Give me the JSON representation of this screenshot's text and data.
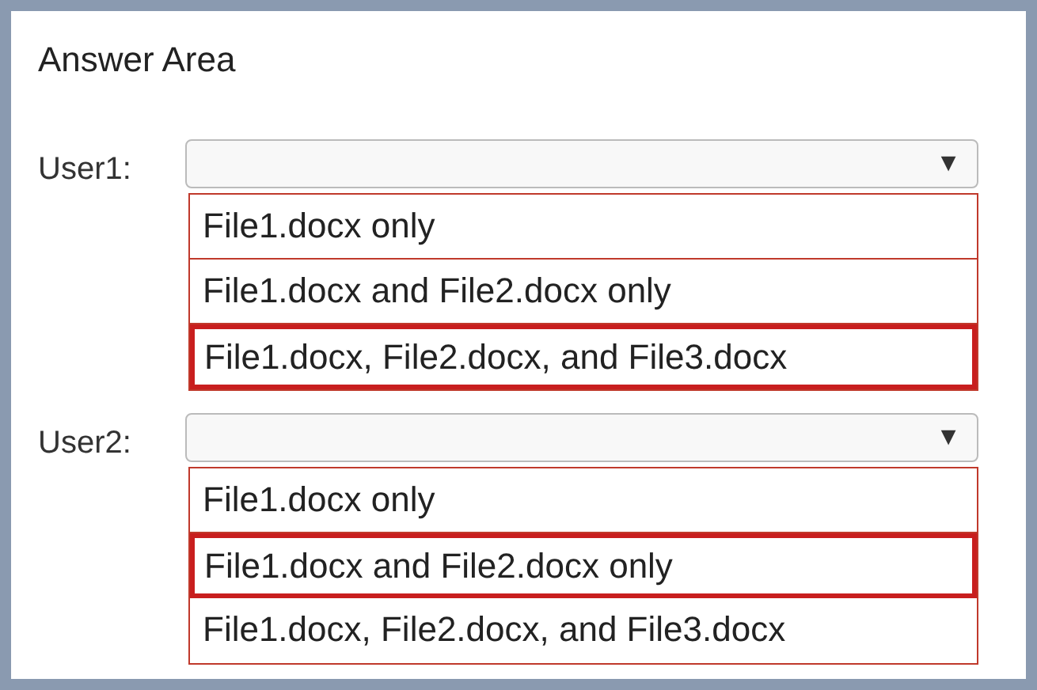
{
  "title": "Answer Area",
  "questions": [
    {
      "label": "User1:",
      "arrow": "▼",
      "options": [
        {
          "text": "File1.docx only",
          "selected": false
        },
        {
          "text": "File1.docx and File2.docx only",
          "selected": false
        },
        {
          "text": "File1.docx, File2.docx, and File3.docx",
          "selected": true
        }
      ]
    },
    {
      "label": "User2:",
      "arrow": "▼",
      "options": [
        {
          "text": "File1.docx only",
          "selected": false
        },
        {
          "text": "File1.docx and File2.docx only",
          "selected": true
        },
        {
          "text": "File1.docx, File2.docx, and File3.docx",
          "selected": false
        }
      ]
    }
  ]
}
